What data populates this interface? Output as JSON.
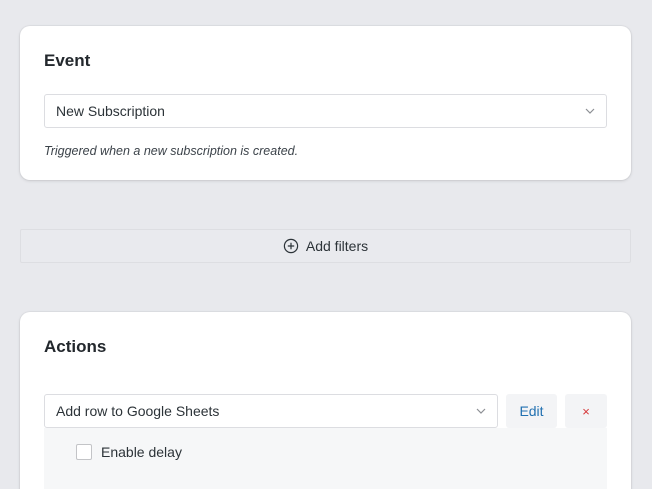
{
  "event": {
    "title": "Event",
    "selected": "New Subscription",
    "help": "Triggered when a new subscription is created."
  },
  "filters": {
    "add_label": "Add filters"
  },
  "actions": {
    "title": "Actions",
    "items": [
      {
        "selected": "Add row to Google Sheets",
        "edit_label": "Edit",
        "remove_label": "×",
        "delay_label": "Enable delay",
        "delay_checked": false
      }
    ]
  },
  "colors": {
    "background": "#e8e9ed",
    "link": "#2271b1",
    "danger": "#d63638"
  },
  "icons": {
    "select_arrow": "chevron-down-icon",
    "add_filters": "plus-circle-icon",
    "remove": "close-icon"
  }
}
